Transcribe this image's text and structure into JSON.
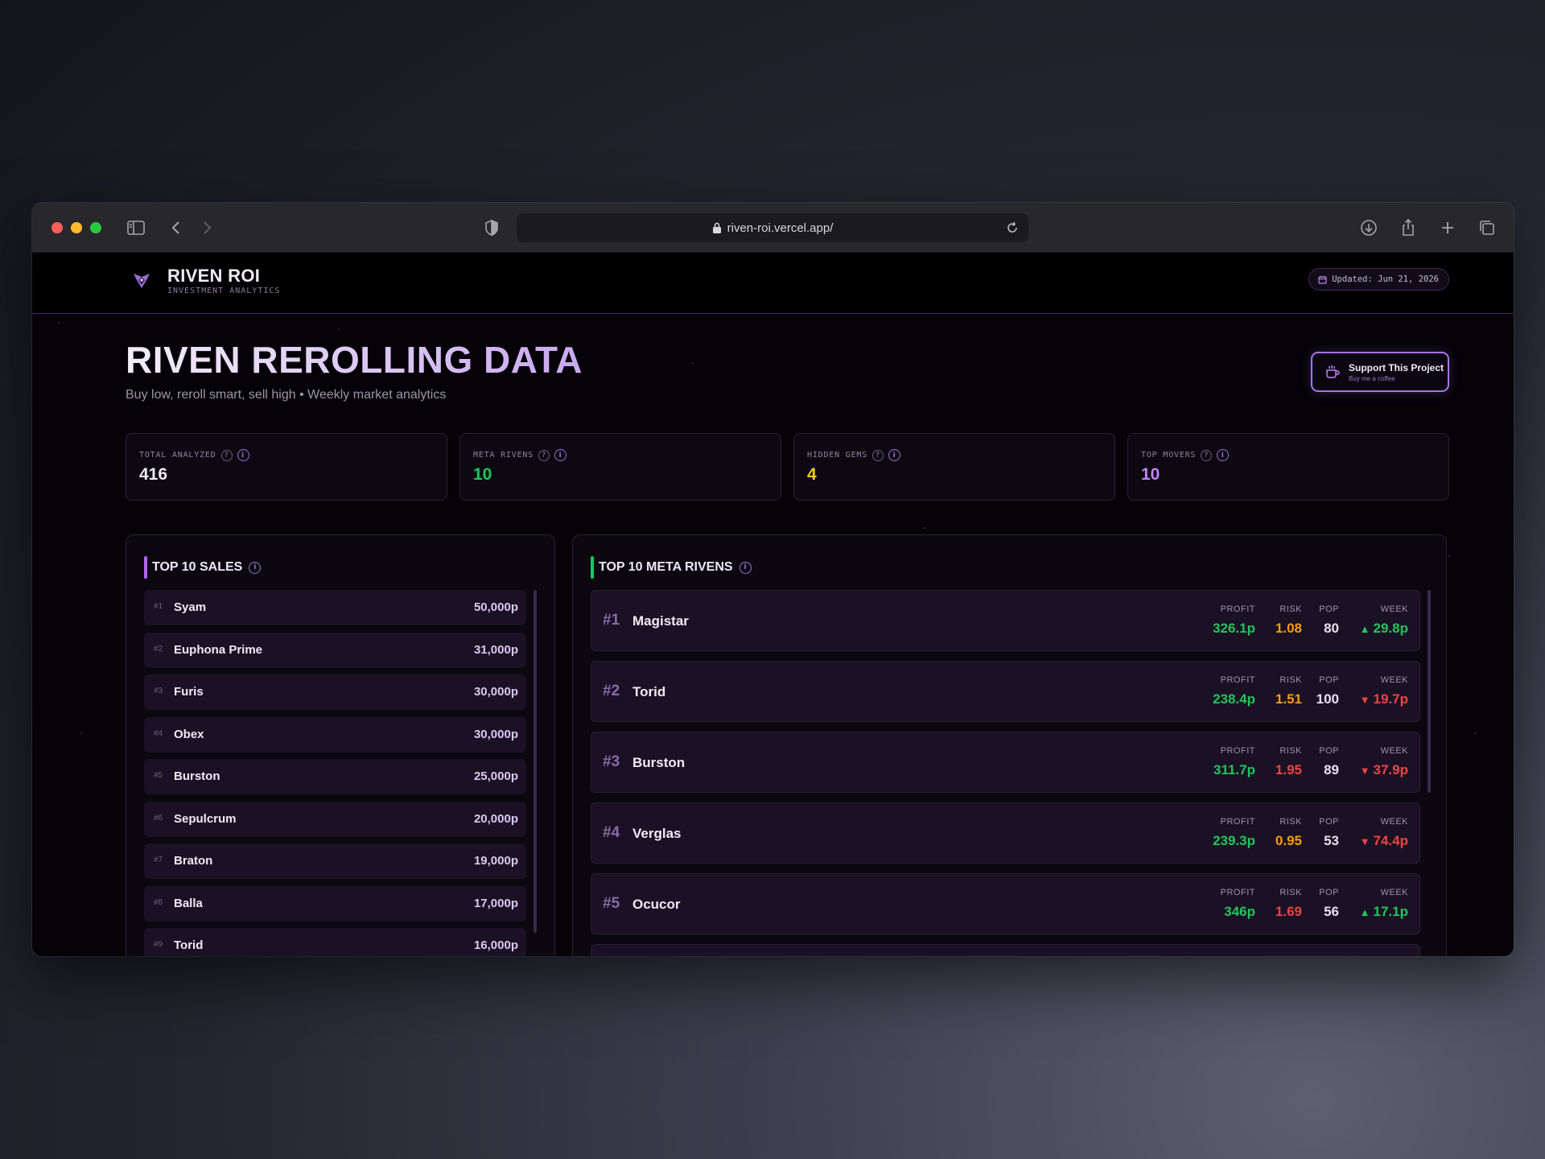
{
  "browser": {
    "url": "riven-roi.vercel.app/"
  },
  "site": {
    "brand_title": "RIVEN ROI",
    "brand_subtitle": "INVESTMENT ANALYTICS",
    "updated": "Updated: Jun 21, 2026"
  },
  "hero": {
    "title": "RIVEN REROLLING DATA",
    "subtitle": "Buy low, reroll smart, sell high • Weekly market analytics",
    "support_title": "Support This Project",
    "support_sub": "Buy me a coffee"
  },
  "stats": [
    {
      "label": "TOTAL ANALYZED",
      "value": "416",
      "color": "#f0eaf6"
    },
    {
      "label": "META RIVENS",
      "value": "10",
      "color": "#22c55e"
    },
    {
      "label": "HIDDEN GEMS",
      "value": "4",
      "color": "#facc15"
    },
    {
      "label": "TOP MOVERS",
      "value": "10",
      "color": "#c084fc"
    }
  ],
  "sales": {
    "title": "TOP 10 SALES",
    "rows": [
      {
        "rank": "#1",
        "name": "Syam",
        "price": "50,000p"
      },
      {
        "rank": "#2",
        "name": "Euphona Prime",
        "price": "31,000p"
      },
      {
        "rank": "#3",
        "name": "Furis",
        "price": "30,000p"
      },
      {
        "rank": "#4",
        "name": "Obex",
        "price": "30,000p"
      },
      {
        "rank": "#5",
        "name": "Burston",
        "price": "25,000p"
      },
      {
        "rank": "#6",
        "name": "Sepulcrum",
        "price": "20,000p"
      },
      {
        "rank": "#7",
        "name": "Braton",
        "price": "19,000p"
      },
      {
        "rank": "#8",
        "name": "Balla",
        "price": "17,000p"
      },
      {
        "rank": "#9",
        "name": "Torid",
        "price": "16,000p"
      }
    ]
  },
  "meta": {
    "title": "TOP 10 META RIVENS",
    "headers": {
      "profit": "PROFIT",
      "risk": "RISK",
      "pop": "POP",
      "week": "WEEK"
    },
    "rows": [
      {
        "rank": "#1",
        "name": "Magistar",
        "profit": "326.1p",
        "risk": "1.08",
        "risk_color": "orange",
        "pop": "80",
        "week": "29.8p",
        "trend": "up"
      },
      {
        "rank": "#2",
        "name": "Torid",
        "profit": "238.4p",
        "risk": "1.51",
        "risk_color": "orange",
        "pop": "100",
        "week": "19.7p",
        "trend": "down"
      },
      {
        "rank": "#3",
        "name": "Burston",
        "profit": "311.7p",
        "risk": "1.95",
        "risk_color": "red",
        "pop": "89",
        "week": "37.9p",
        "trend": "down"
      },
      {
        "rank": "#4",
        "name": "Verglas",
        "profit": "239.3p",
        "risk": "0.95",
        "risk_color": "orange",
        "pop": "53",
        "week": "74.4p",
        "trend": "down"
      },
      {
        "rank": "#5",
        "name": "Ocucor",
        "profit": "346p",
        "risk": "1.69",
        "risk_color": "red",
        "pop": "56",
        "week": "17.1p",
        "trend": "up"
      }
    ]
  }
}
